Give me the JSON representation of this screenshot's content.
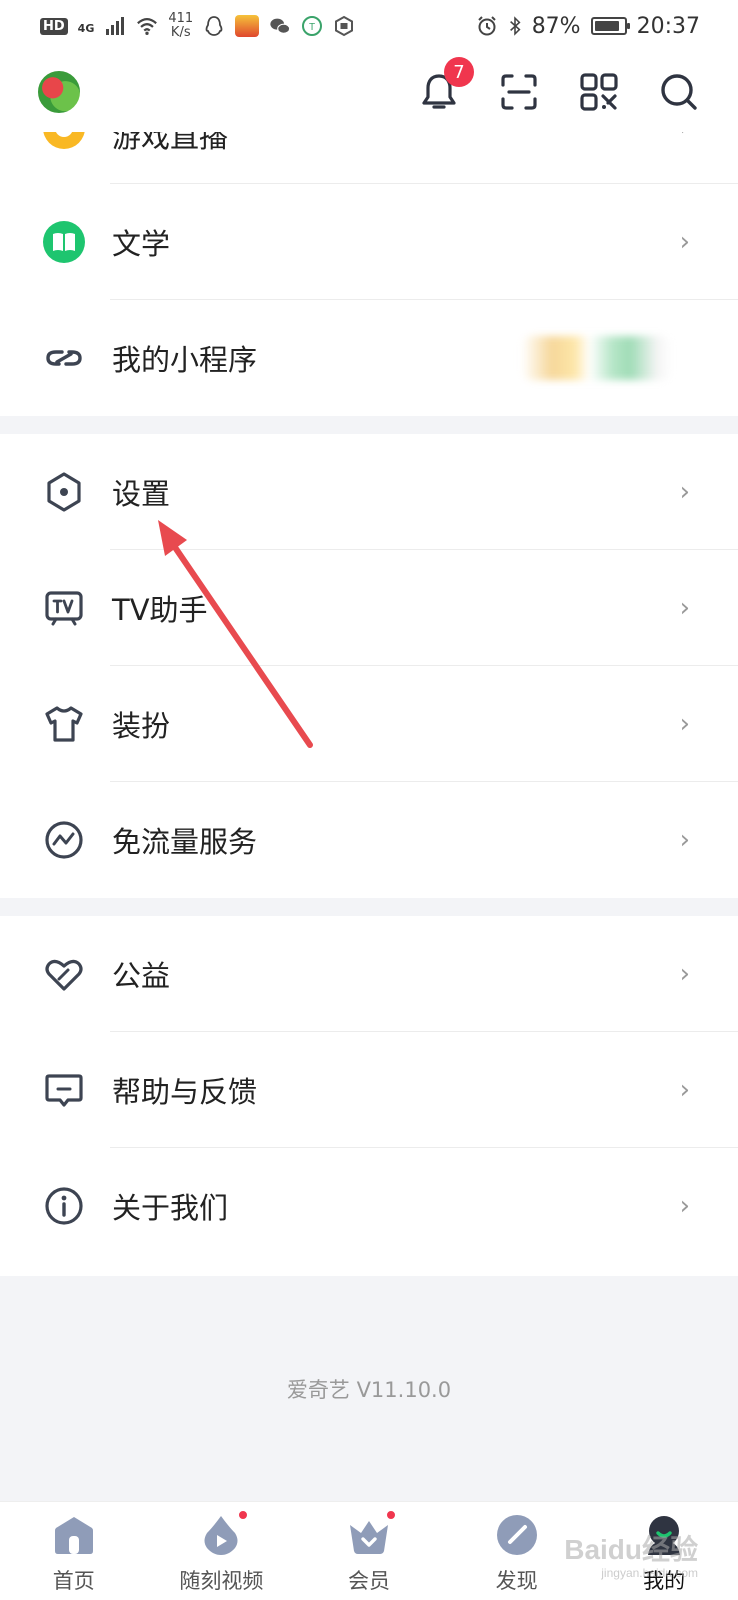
{
  "status_bar": {
    "hd": "HD",
    "network": "4G",
    "speed_top": "411",
    "speed_bottom": "K/s",
    "battery_percent": "87%",
    "battery_level": 0.87,
    "time": "20:37"
  },
  "header": {
    "notification_count": "7"
  },
  "menu": {
    "partial_label": "游戏直播",
    "items": [
      {
        "label": "文学"
      },
      {
        "label": "我的小程序"
      },
      {
        "label": "设置"
      },
      {
        "label": "TV助手"
      },
      {
        "label": "装扮"
      },
      {
        "label": "免流量服务"
      },
      {
        "label": "公益"
      },
      {
        "label": "帮助与反馈"
      },
      {
        "label": "关于我们"
      }
    ],
    "chevron": "›"
  },
  "version": "爱奇艺 V11.10.0",
  "bottom_nav": [
    {
      "label": "首页"
    },
    {
      "label": "随刻视频"
    },
    {
      "label": "会员"
    },
    {
      "label": "发现"
    },
    {
      "label": "我的"
    }
  ],
  "colors": {
    "accent": "#f0364e",
    "icon": "#3d4452",
    "green": "#1ec56f",
    "orange": "#f9b824",
    "nav_icon": "#8f9cb8"
  },
  "watermark": {
    "main": "Baidu经验",
    "sub": "jingyan.baidu.com"
  }
}
